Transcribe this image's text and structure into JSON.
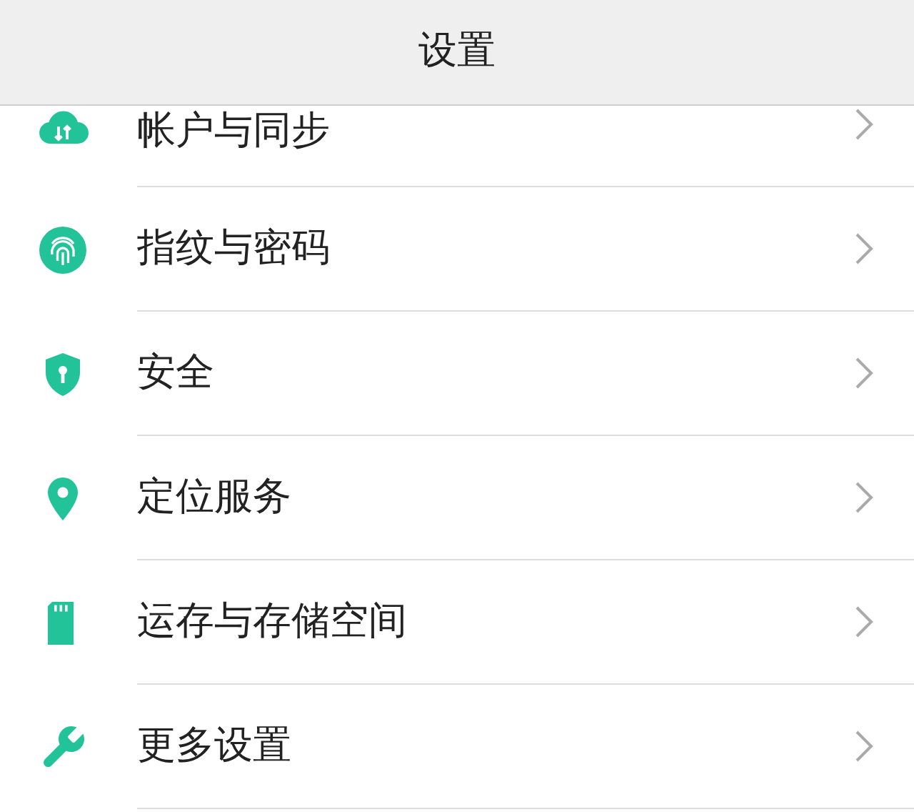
{
  "header": {
    "title": "设置"
  },
  "items": [
    {
      "kind": "cloud",
      "label": "帐户与同步",
      "cut": true
    },
    {
      "kind": "fingerprint",
      "label": "指纹与密码",
      "cut": false
    },
    {
      "kind": "shield",
      "label": "安全",
      "cut": false
    },
    {
      "kind": "pin",
      "label": "定位服务",
      "cut": false
    },
    {
      "kind": "card",
      "label": "运存与存储空间",
      "cut": false
    },
    {
      "kind": "wrench",
      "label": "更多设置",
      "cut": false
    }
  ]
}
